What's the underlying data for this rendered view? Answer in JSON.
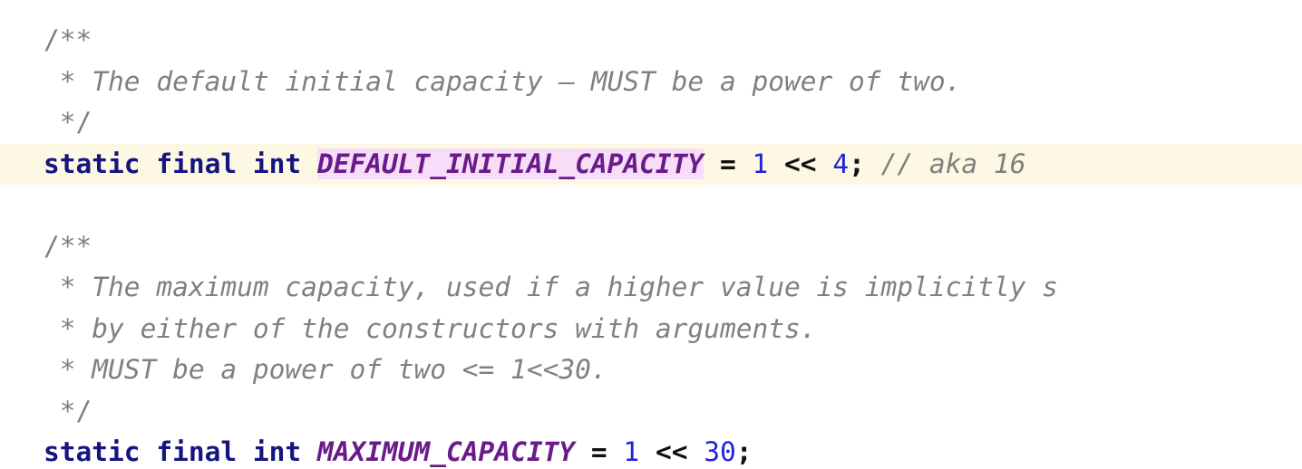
{
  "editor": {
    "language": "java",
    "font_size_px": 29.5,
    "colors": {
      "background": "#ffffff",
      "current_line_highlight": "#fdf8e3",
      "occurrence_highlight": "#f7ddf7",
      "comment": "#808080",
      "keyword": "#151580",
      "identifier": "#6a1b8a",
      "number": "#2222dd",
      "operator": "#101010"
    }
  },
  "lines": [
    {
      "index": 0,
      "highlighted": false,
      "tokens": [
        {
          "kind": "comment-plain",
          "text": "/**"
        }
      ]
    },
    {
      "index": 1,
      "highlighted": false,
      "tokens": [
        {
          "kind": "comment",
          "text": " * The default initial capacity — MUST be a power of two."
        }
      ]
    },
    {
      "index": 2,
      "highlighted": false,
      "tokens": [
        {
          "kind": "comment-plain",
          "text": " */"
        }
      ]
    },
    {
      "index": 3,
      "highlighted": true,
      "tokens": [
        {
          "kind": "keyword",
          "text": "static final int "
        },
        {
          "kind": "identifier-occurrence",
          "text": "DEFAULT_INITIAL_CAPACITY"
        },
        {
          "kind": "plain",
          "text": " "
        },
        {
          "kind": "operator",
          "text": "="
        },
        {
          "kind": "plain",
          "text": " "
        },
        {
          "kind": "number",
          "text": "1"
        },
        {
          "kind": "plain",
          "text": " "
        },
        {
          "kind": "operator",
          "text": "<<"
        },
        {
          "kind": "plain",
          "text": " "
        },
        {
          "kind": "number",
          "text": "4"
        },
        {
          "kind": "punct",
          "text": ";"
        },
        {
          "kind": "plain",
          "text": " "
        },
        {
          "kind": "comment",
          "text": "// aka 16"
        }
      ]
    },
    {
      "index": 4,
      "highlighted": false,
      "tokens": []
    },
    {
      "index": 5,
      "highlighted": false,
      "tokens": [
        {
          "kind": "comment-plain",
          "text": "/**"
        }
      ]
    },
    {
      "index": 6,
      "highlighted": false,
      "tokens": [
        {
          "kind": "comment",
          "text": " * The maximum capacity, used if a higher value is implicitly s"
        }
      ]
    },
    {
      "index": 7,
      "highlighted": false,
      "tokens": [
        {
          "kind": "comment",
          "text": " * by either of the constructors with arguments."
        }
      ]
    },
    {
      "index": 8,
      "highlighted": false,
      "tokens": [
        {
          "kind": "comment",
          "text": " * MUST be a power of two <= 1<<30."
        }
      ]
    },
    {
      "index": 9,
      "highlighted": false,
      "tokens": [
        {
          "kind": "comment-plain",
          "text": " */"
        }
      ]
    },
    {
      "index": 10,
      "highlighted": false,
      "tokens": [
        {
          "kind": "keyword",
          "text": "static final int "
        },
        {
          "kind": "identifier",
          "text": "MAXIMUM_CAPACITY"
        },
        {
          "kind": "plain",
          "text": " "
        },
        {
          "kind": "operator",
          "text": "="
        },
        {
          "kind": "plain",
          "text": " "
        },
        {
          "kind": "number",
          "text": "1"
        },
        {
          "kind": "plain",
          "text": " "
        },
        {
          "kind": "operator",
          "text": "<<"
        },
        {
          "kind": "plain",
          "text": " "
        },
        {
          "kind": "number",
          "text": "30"
        },
        {
          "kind": "punct",
          "text": ";"
        }
      ]
    }
  ]
}
